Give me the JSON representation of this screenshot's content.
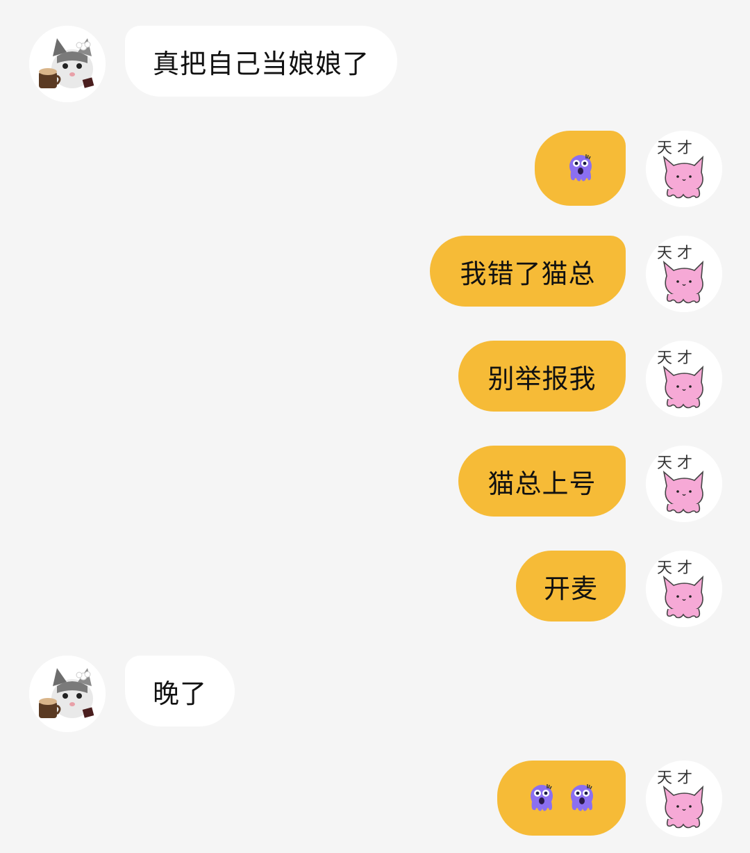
{
  "messages": [
    {
      "side": "left",
      "text": "真把自己当娘娘了"
    },
    {
      "side": "right",
      "emoji": "shocked-octopus",
      "emoji_count": 1
    },
    {
      "side": "right",
      "text": "我错了猫总"
    },
    {
      "side": "right",
      "text": "别举报我"
    },
    {
      "side": "right",
      "text": "猫总上号"
    },
    {
      "side": "right",
      "text": "开麦"
    },
    {
      "side": "left",
      "text": "晚了"
    },
    {
      "side": "right",
      "emoji": "shocked-octopus",
      "emoji_count": 2
    }
  ],
  "self_avatar": {
    "caption": "天 才",
    "icon": "pink-cat-doodle"
  },
  "other_avatar": {
    "icon": "kitten-with-coffee"
  },
  "colors": {
    "background": "#f5f5f5",
    "incoming_bubble": "#ffffff",
    "outgoing_bubble": "#f6bb37",
    "text": "#111111"
  }
}
